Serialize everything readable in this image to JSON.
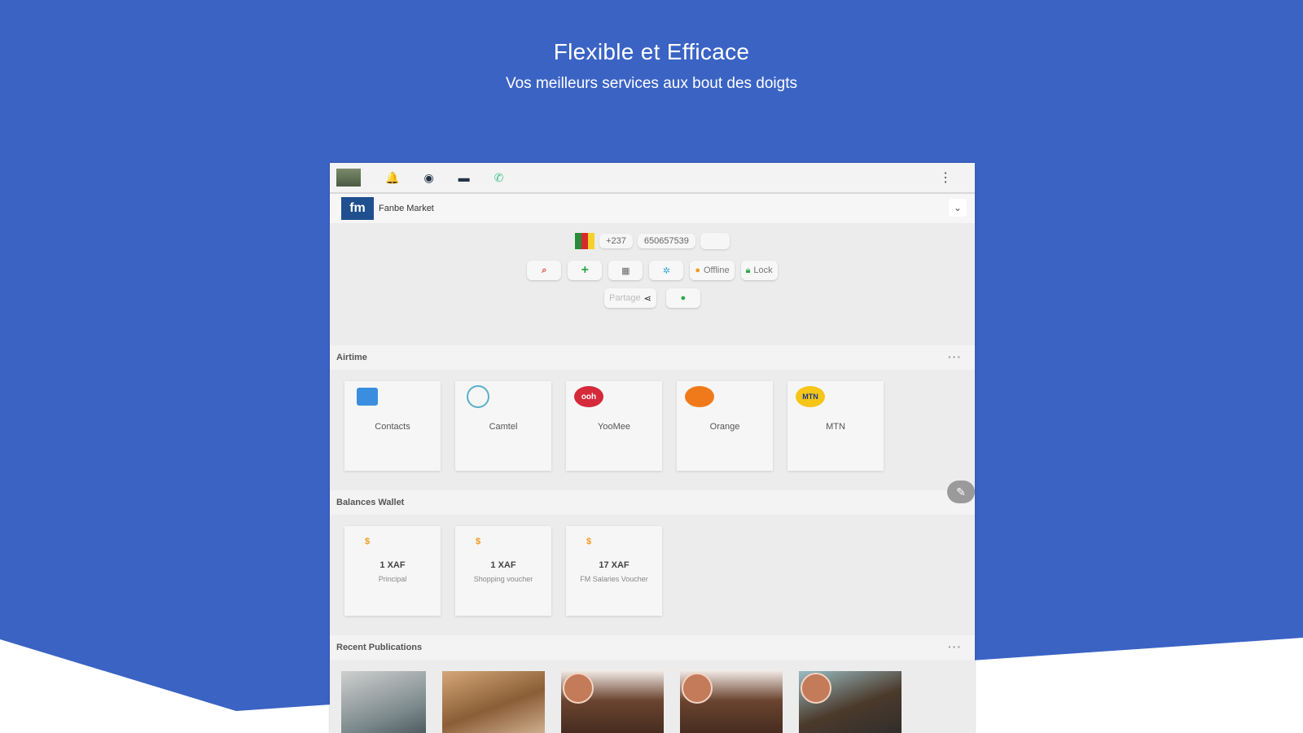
{
  "hero": {
    "title": "Flexible et Efficace",
    "subtitle": "Vos meilleurs services aux bout des doigts"
  },
  "colors": {
    "background": "#3a63c4",
    "accent_orange": "#f09a22"
  },
  "statusbar": {
    "icons": [
      "photo-thumbnail",
      "bell-icon",
      "globe-icon",
      "card-icon",
      "phone-icon",
      "kebab-menu-icon"
    ],
    "more": "⋮"
  },
  "appbar": {
    "logo": "fm",
    "name": "Fanbe Market"
  },
  "controls": {
    "country_code": "+237",
    "phone": "650657539",
    "offline_label": "Offline",
    "lock_label": "Lock",
    "share_label": "Partage"
  },
  "airtime": {
    "title": "Airtime",
    "more": "···",
    "items": [
      {
        "label": "Contacts",
        "icon": "contacts-icon"
      },
      {
        "label": "Camtel",
        "icon": "camtel-icon"
      },
      {
        "label": "YooMee",
        "icon": "yoomee-icon",
        "logo_text": "ooh"
      },
      {
        "label": "Orange",
        "icon": "orange-icon"
      },
      {
        "label": "MTN",
        "icon": "mtn-icon",
        "logo_text": "MTN"
      }
    ]
  },
  "wallet": {
    "title": "Balances Wallet",
    "items": [
      {
        "amount": "1 XAF",
        "label": "Principal"
      },
      {
        "amount": "1 XAF",
        "label": "Shopping voucher"
      },
      {
        "amount": "17 XAF",
        "label": "FM Salaries Voucher"
      }
    ]
  },
  "publications": {
    "title": "Recent Publications",
    "more": "···"
  }
}
